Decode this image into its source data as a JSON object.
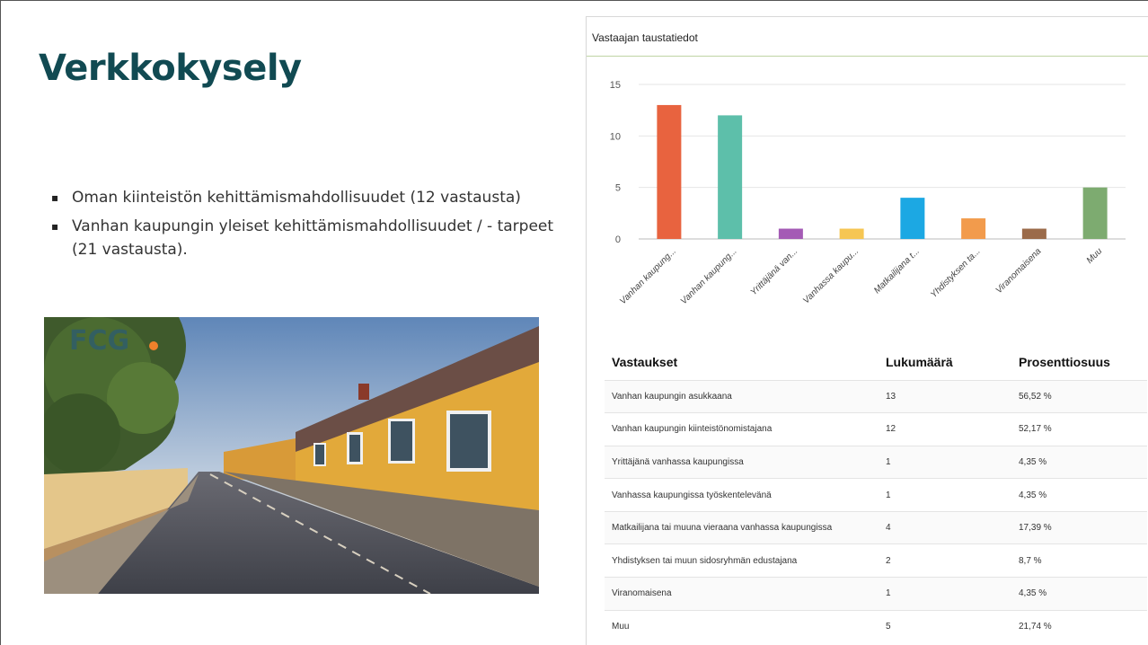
{
  "slide": {
    "title": "Verkkokysely",
    "bullets": [
      "Oman kiinteistön kehittämismahdollisuudet (12 vastausta)",
      "Vanhan kaupungin yleiset kehittämismahdollisuudet / - tarpeet (21 vastausta)."
    ],
    "photo_logo": "FCG"
  },
  "panel": {
    "header": "Vastaajan taustatiedot"
  },
  "chart_data": {
    "type": "bar",
    "categories": [
      "Vanhan kaupung...",
      "Vanhan kaupung...",
      "Yrittäjänä van...",
      "Vanhassa kaupu...",
      "Matkailijana t...",
      "Yhdistyksen ta...",
      "Viranomaisena",
      "Muu"
    ],
    "values": [
      13,
      12,
      1,
      1,
      4,
      2,
      1,
      5
    ],
    "colors": [
      "#e8633f",
      "#5dbfaa",
      "#a45bb5",
      "#f6c653",
      "#1ca8e3",
      "#f29b4c",
      "#9b6b4a",
      "#7dab70"
    ],
    "ylim": [
      0,
      15
    ],
    "yticks": [
      0,
      5,
      10,
      15
    ],
    "grid": true
  },
  "table": {
    "headers": [
      "Vastaukset",
      "Lukumäärä",
      "Prosenttiosuus"
    ],
    "rows": [
      [
        "Vanhan kaupungin asukkaana",
        "13",
        "56,52 %"
      ],
      [
        "Vanhan kaupungin kiinteistönomistajana",
        "12",
        "52,17 %"
      ],
      [
        "Yrittäjänä vanhassa kaupungissa",
        "1",
        "4,35 %"
      ],
      [
        "Vanhassa kaupungissa työskentelevänä",
        "1",
        "4,35 %"
      ],
      [
        "Matkailijana tai muuna vieraana vanhassa kaupungissa",
        "4",
        "17,39 %"
      ],
      [
        "Yhdistyksen tai muun sidosryhmän edustajana",
        "2",
        "8,7 %"
      ],
      [
        "Viranomaisena",
        "1",
        "4,35 %"
      ],
      [
        "Muu",
        "5",
        "21,74 %"
      ]
    ]
  }
}
